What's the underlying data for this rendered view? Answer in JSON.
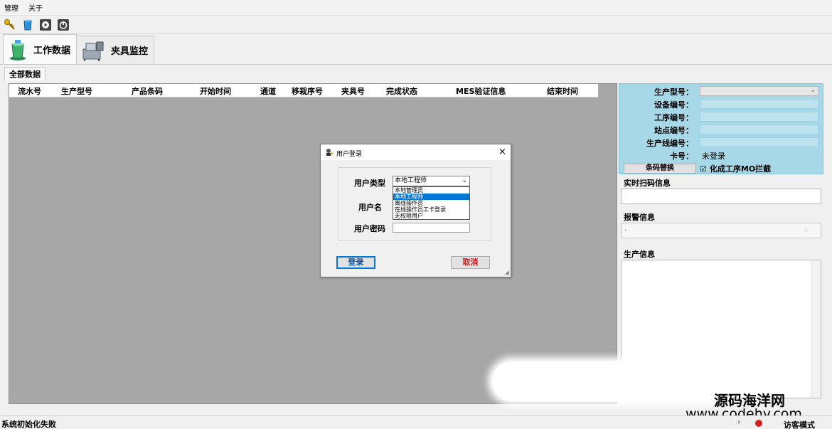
{
  "menu": [
    "管理",
    "关于"
  ],
  "toolbar": {
    "icons": [
      "key-icon",
      "database-icon",
      "play-icon",
      "power-icon"
    ]
  },
  "main_tabs": [
    {
      "label": "工作数据",
      "icon": "data-icon"
    },
    {
      "label": "夹具监控",
      "icon": "fixture-icon"
    }
  ],
  "sub_tab": "全部数据",
  "grid": {
    "columns": [
      "流水号",
      "生产型号",
      "产品条码",
      "开始时间",
      "通道",
      "移栽序号",
      "夹具号",
      "完成状态",
      "MES验证信息",
      "结束时间"
    ]
  },
  "info_panel": {
    "model_label": "生产型号：",
    "device_label": "设备编号：",
    "process_label": "工序编号：",
    "station_label": "站点编号：",
    "line_label": "生产线编号：",
    "card_label": "卡号：",
    "card_value": "未登录",
    "barcode_button": "条码替换",
    "checkbox_label": "化成工序MO拦截",
    "checkbox_checked": "☑"
  },
  "scan_section": "实时扫码信息",
  "alarm_section": "报警信息",
  "production_section": "生产信息",
  "status": {
    "left": "系统初始化失败",
    "right": "访客模式"
  },
  "dialog": {
    "title": "用户登录",
    "user_type_label": "用户类型",
    "username_label": "用户名",
    "password_label": "用户密码",
    "selected_type": "本地工程师",
    "options": [
      "本地管理员",
      "本地工程师",
      "离线操作员",
      "在线操作员工卡登录",
      "无权限用户"
    ],
    "selected_index": 1,
    "login_button": "登录",
    "cancel_button": "取消"
  },
  "watermark": {
    "cn": "源码海洋网",
    "url": "www.codehy.com"
  },
  "colors": {
    "info_bg": "#a7d8e8",
    "grid_bg": "#a7a7a7",
    "selection": "#0078d7",
    "cancel_text": "#c61c1c"
  }
}
